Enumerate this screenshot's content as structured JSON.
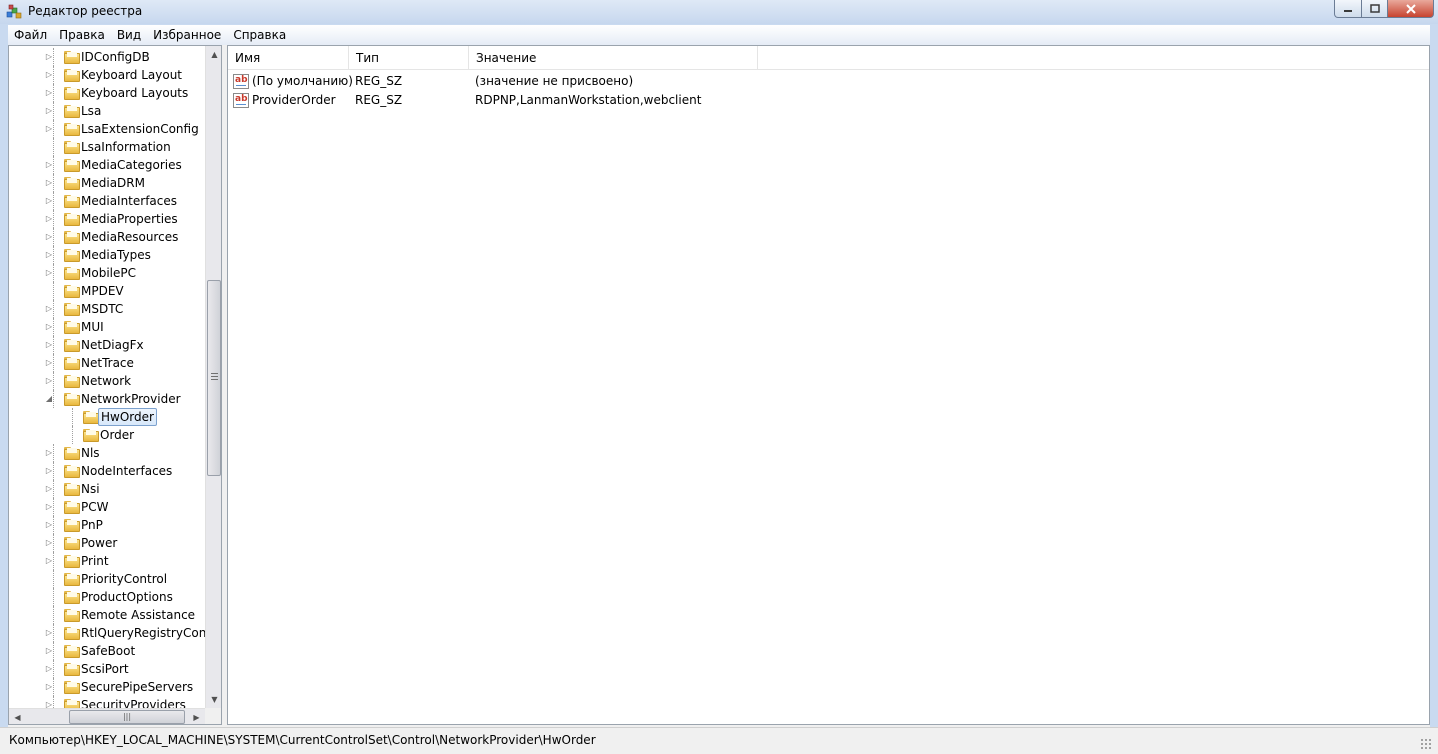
{
  "window": {
    "title": "Редактор реестра"
  },
  "menu": [
    "Файл",
    "Правка",
    "Вид",
    "Избранное",
    "Справка"
  ],
  "tree": {
    "items": [
      {
        "label": "IDConfigDB",
        "expander": "collapsed",
        "level": 1
      },
      {
        "label": "Keyboard Layout",
        "expander": "collapsed",
        "level": 1
      },
      {
        "label": "Keyboard Layouts",
        "expander": "collapsed",
        "level": 1
      },
      {
        "label": "Lsa",
        "expander": "collapsed",
        "level": 1
      },
      {
        "label": "LsaExtensionConfig",
        "expander": "collapsed",
        "level": 1
      },
      {
        "label": "LsaInformation",
        "expander": "none",
        "level": 1
      },
      {
        "label": "MediaCategories",
        "expander": "collapsed",
        "level": 1
      },
      {
        "label": "MediaDRM",
        "expander": "collapsed",
        "level": 1
      },
      {
        "label": "MediaInterfaces",
        "expander": "collapsed",
        "level": 1
      },
      {
        "label": "MediaProperties",
        "expander": "collapsed",
        "level": 1
      },
      {
        "label": "MediaResources",
        "expander": "collapsed",
        "level": 1
      },
      {
        "label": "MediaTypes",
        "expander": "collapsed",
        "level": 1
      },
      {
        "label": "MobilePC",
        "expander": "collapsed",
        "level": 1
      },
      {
        "label": "MPDEV",
        "expander": "none",
        "level": 1
      },
      {
        "label": "MSDTC",
        "expander": "collapsed",
        "level": 1
      },
      {
        "label": "MUI",
        "expander": "collapsed",
        "level": 1
      },
      {
        "label": "NetDiagFx",
        "expander": "collapsed",
        "level": 1
      },
      {
        "label": "NetTrace",
        "expander": "collapsed",
        "level": 1
      },
      {
        "label": "Network",
        "expander": "collapsed",
        "level": 1
      },
      {
        "label": "NetworkProvider",
        "expander": "expanded",
        "level": 1
      },
      {
        "label": "HwOrder",
        "expander": "none",
        "level": 2,
        "selected": true
      },
      {
        "label": "Order",
        "expander": "none",
        "level": 2
      },
      {
        "label": "Nls",
        "expander": "collapsed",
        "level": 1
      },
      {
        "label": "NodeInterfaces",
        "expander": "collapsed",
        "level": 1
      },
      {
        "label": "Nsi",
        "expander": "collapsed",
        "level": 1
      },
      {
        "label": "PCW",
        "expander": "collapsed",
        "level": 1
      },
      {
        "label": "PnP",
        "expander": "collapsed",
        "level": 1
      },
      {
        "label": "Power",
        "expander": "collapsed",
        "level": 1
      },
      {
        "label": "Print",
        "expander": "collapsed",
        "level": 1
      },
      {
        "label": "PriorityControl",
        "expander": "none",
        "level": 1
      },
      {
        "label": "ProductOptions",
        "expander": "none",
        "level": 1
      },
      {
        "label": "Remote Assistance",
        "expander": "none",
        "level": 1
      },
      {
        "label": "RtlQueryRegistryConfig",
        "expander": "collapsed",
        "level": 1
      },
      {
        "label": "SafeBoot",
        "expander": "collapsed",
        "level": 1
      },
      {
        "label": "ScsiPort",
        "expander": "collapsed",
        "level": 1
      },
      {
        "label": "SecurePipeServers",
        "expander": "collapsed",
        "level": 1
      },
      {
        "label": "SecurityProviders",
        "expander": "collapsed",
        "level": 1
      }
    ]
  },
  "list": {
    "columns": [
      "Имя",
      "Тип",
      "Значение"
    ],
    "rows": [
      {
        "name": "(По умолчанию)",
        "type": "REG_SZ",
        "value": "(значение не присвоено)",
        "icon": "string-value-icon"
      },
      {
        "name": "ProviderOrder",
        "type": "REG_SZ",
        "value": "RDPNP,LanmanWorkstation,webclient",
        "icon": "string-value-icon"
      }
    ]
  },
  "status": {
    "path": "Компьютер\\HKEY_LOCAL_MACHINE\\SYSTEM\\CurrentControlSet\\Control\\NetworkProvider\\HwOrder"
  },
  "glyphs": {
    "collapsed": "▷",
    "expanded": "◢",
    "scroll_up": "▲",
    "scroll_down": "▼",
    "scroll_left": "◀",
    "scroll_right": "▶",
    "h_grip": "|||"
  },
  "colors": {
    "selection_border": "#7da2ce",
    "folder": "#e9b83f",
    "close_button": "#c7432f"
  }
}
